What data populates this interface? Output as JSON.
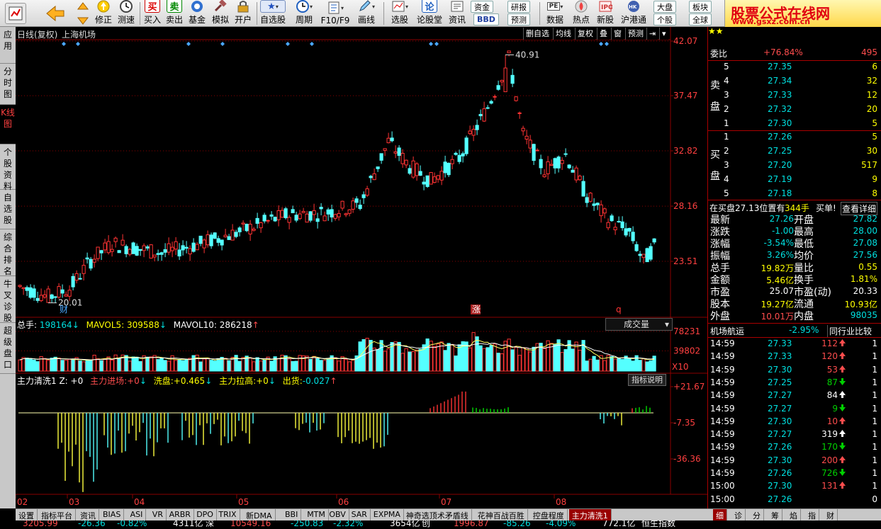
{
  "toolbar": {
    "buttons": [
      {
        "label": "修正",
        "icon": "up-arrow-icon"
      },
      {
        "label": "测速",
        "icon": "clock-icon"
      },
      {
        "label": "买入",
        "icon": "buy-icon",
        "glyph": "买"
      },
      {
        "label": "卖出",
        "icon": "sell-icon",
        "glyph": "卖"
      },
      {
        "label": "基金",
        "icon": "fund-icon"
      },
      {
        "label": "模拟",
        "icon": "gavel-icon"
      },
      {
        "label": "开户",
        "icon": "lock-icon"
      },
      {
        "label": "自选股",
        "icon": "star-icon"
      },
      {
        "label": "周期",
        "icon": "cycle-clock-icon"
      },
      {
        "label": "F10/F9",
        "icon": "f10-icon"
      },
      {
        "label": "画线",
        "icon": "pencil-icon"
      },
      {
        "label": "选股",
        "icon": "select-stock-icon"
      },
      {
        "label": "论股堂",
        "icon": "forum-icon",
        "glyph": "论"
      },
      {
        "label": "资讯",
        "icon": "news-icon"
      },
      {
        "label": "数据",
        "icon": "data-icon"
      },
      {
        "label": "热点",
        "icon": "hot-icon"
      },
      {
        "label": "新股",
        "icon": "ipo-icon"
      },
      {
        "label": "沪港通",
        "icon": "hk-connect-icon"
      }
    ],
    "minis": {
      "capital": "资金",
      "research": "研报",
      "forecast": "预测",
      "bbd": "BBD",
      "pe": "PE",
      "market": "大盘",
      "sector": "板块",
      "single": "个股",
      "global": "全球"
    }
  },
  "brand": {
    "title": "股票公式在线网",
    "url": "www.gsxz.com.cn"
  },
  "left_tabs": [
    "应用",
    "分时图",
    "K线图",
    "个股资料",
    "自选股",
    "综合排名",
    "牛叉诊股",
    "超级盘口"
  ],
  "chart": {
    "header_left": "日线(复权)",
    "stock_name": "上海机场",
    "controls": [
      "删自选",
      "均线",
      "复权",
      "叠",
      "窗",
      "预测"
    ],
    "price_ticks": [
      "42.07",
      "37.47",
      "32.82",
      "28.16",
      "23.51"
    ],
    "high_label": "40.91",
    "low_label": "20.01",
    "markers": {
      "cai": "财",
      "zhang": "涨",
      "q": "q"
    },
    "vol_header": {
      "total_label": "总手:",
      "total": "198164",
      "mavol5_label": "MAVOL5:",
      "mavol5": "309588",
      "mavol10_label": "MAVOL10:",
      "mavol10": "286218"
    },
    "vol_select": "成交量",
    "vol_ticks": [
      "78231",
      "39802"
    ],
    "vol_unit": "X10",
    "ind_header": {
      "name": "主力清洗1 Z:",
      "z": "+0",
      "jinchang_label": "主力进场:",
      "jinchang": "+0",
      "xipan_label": "洗盘:",
      "xipan": "+0.465",
      "lagao_label": "主力拉高:",
      "lagao": "+0",
      "chuhuo_label": "出货:",
      "chuhuo": "-0.027"
    },
    "ind_btn": "指标说明",
    "ind_ticks": [
      "+21.67",
      "-7.35",
      "-36.36"
    ],
    "months": [
      "02",
      "03",
      "04",
      "05",
      "06",
      "07",
      "08"
    ],
    "colors": {
      "up": "#ff3333",
      "down": "#54ffff",
      "grid": "#8a0000",
      "yellow": "#ffff40",
      "green": "#00dd00"
    }
  },
  "chart_data": {
    "type": "candlestick",
    "price_axis": {
      "min": 20.01,
      "max": 42.07,
      "ticks": [
        42.07,
        37.47,
        32.82,
        28.16,
        23.51
      ]
    },
    "volume_axis": {
      "ticks": [
        78231,
        39802
      ],
      "unit": "X10"
    },
    "indicator_axis": {
      "ticks": [
        21.67,
        -7.35,
        -36.36
      ]
    },
    "x_months": [
      "02",
      "03",
      "04",
      "05",
      "06",
      "07",
      "08"
    ]
  },
  "right_panel": {
    "weibi_label": "委比",
    "weibi": "+76.84%",
    "weicha": "495",
    "sell_label": [
      "卖",
      "盘"
    ],
    "buy_label": [
      "买",
      "盘"
    ],
    "sell": [
      {
        "lvl": "5",
        "price": "27.35",
        "vol": "6"
      },
      {
        "lvl": "4",
        "price": "27.34",
        "vol": "32"
      },
      {
        "lvl": "3",
        "price": "27.33",
        "vol": "12"
      },
      {
        "lvl": "2",
        "price": "27.32",
        "vol": "20"
      },
      {
        "lvl": "1",
        "price": "27.30",
        "vol": "5"
      }
    ],
    "buy": [
      {
        "lvl": "1",
        "price": "27.26",
        "vol": "5"
      },
      {
        "lvl": "2",
        "price": "27.25",
        "vol": "30"
      },
      {
        "lvl": "3",
        "price": "27.20",
        "vol": "517"
      },
      {
        "lvl": "4",
        "price": "27.19",
        "vol": "9"
      },
      {
        "lvl": "5",
        "price": "27.18",
        "vol": "8"
      }
    ],
    "position_line": {
      "prefix": "在买盘27.13位置有",
      "qty": "344手",
      "single": "买单!",
      "detail": "查看详细"
    },
    "stats": [
      {
        "l1": "最新",
        "v1": "27.26",
        "c1": "g",
        "l2": "开盘",
        "v2": "27.82",
        "c2": "g"
      },
      {
        "l1": "涨跌",
        "v1": "-1.00",
        "c1": "g",
        "l2": "最高",
        "v2": "28.00",
        "c2": "g"
      },
      {
        "l1": "涨幅",
        "v1": "-3.54%",
        "c1": "g",
        "l2": "最低",
        "v2": "27.08",
        "c2": "g"
      },
      {
        "l1": "振幅",
        "v1": "3.26%",
        "c1": "g",
        "l2": "均价",
        "v2": "27.56",
        "c2": "g"
      },
      {
        "l1": "总手",
        "v1": "19.82万",
        "c1": "y",
        "l2": "量比",
        "v2": "0.55",
        "c2": "y"
      },
      {
        "l1": "金额",
        "v1": "5.46亿",
        "c1": "y",
        "l2": "换手",
        "v2": "1.81%",
        "c2": "y"
      },
      {
        "l1": "市盈",
        "v1": "25.07",
        "c1": "w",
        "l2": "市盈(动)",
        "v2": "20.33",
        "c2": "w"
      },
      {
        "l1": "股本",
        "v1": "19.27亿",
        "c1": "y",
        "l2": "流通",
        "v2": "10.93亿",
        "c2": "y"
      },
      {
        "l1": "外盘",
        "v1": "10.01万",
        "c1": "r",
        "l2": "内盘",
        "v2": "98035",
        "c2": "g"
      }
    ],
    "sector": {
      "name": "机场航运",
      "change": "-2.95%",
      "compare": "同行业比较"
    },
    "ticks": [
      {
        "t": "14:59",
        "p": "27.33",
        "v": "112",
        "d": "up",
        "n": "1"
      },
      {
        "t": "14:59",
        "p": "27.33",
        "v": "120",
        "d": "up",
        "n": "1"
      },
      {
        "t": "14:59",
        "p": "27.30",
        "v": "53",
        "d": "up",
        "n": "1"
      },
      {
        "t": "14:59",
        "p": "27.25",
        "v": "87",
        "d": "down",
        "n": "1"
      },
      {
        "t": "14:59",
        "p": "27.27",
        "v": "84",
        "d": "neutral",
        "n": "1"
      },
      {
        "t": "14:59",
        "p": "27.27",
        "v": "9",
        "d": "down",
        "n": "1"
      },
      {
        "t": "14:59",
        "p": "27.30",
        "v": "10",
        "d": "up",
        "n": "1"
      },
      {
        "t": "14:59",
        "p": "27.27",
        "v": "319",
        "d": "neutral",
        "n": "1"
      },
      {
        "t": "14:59",
        "p": "27.26",
        "v": "170",
        "d": "down",
        "n": "1"
      },
      {
        "t": "14:59",
        "p": "27.30",
        "v": "200",
        "d": "up",
        "n": "1"
      },
      {
        "t": "14:59",
        "p": "27.26",
        "v": "726",
        "d": "down",
        "n": "1"
      },
      {
        "t": "15:00",
        "p": "27.30",
        "v": "131",
        "d": "up",
        "n": "1"
      },
      {
        "t": "15:00",
        "p": "27.26",
        "v": "",
        "d": "",
        "n": "0"
      }
    ]
  },
  "bottom_tabs": [
    "设置",
    "指标平台",
    "资讯",
    "BIAS",
    "ASI",
    "VR",
    "ARBR",
    "DPO",
    "TRIX",
    "新DMA",
    "BBI",
    "MTM",
    "OBV",
    "SAR",
    "EXPMA",
    "神奇选顶术矛盾线",
    "花神百战百胜",
    "控盘程度",
    "主力清洗1"
  ],
  "right_tabs": [
    "细",
    "诊",
    "分",
    "筹",
    "焰",
    "指",
    "财"
  ],
  "statusbar": [
    "3205.99",
    "-26.36",
    "-0.82%",
    "4311亿",
    "深",
    "10549.16",
    "-250.83",
    "-2.32%",
    "3654亿",
    "创",
    "1996.87",
    "-85.26",
    "-4.09%",
    "772.1亿",
    "恒生指数"
  ]
}
